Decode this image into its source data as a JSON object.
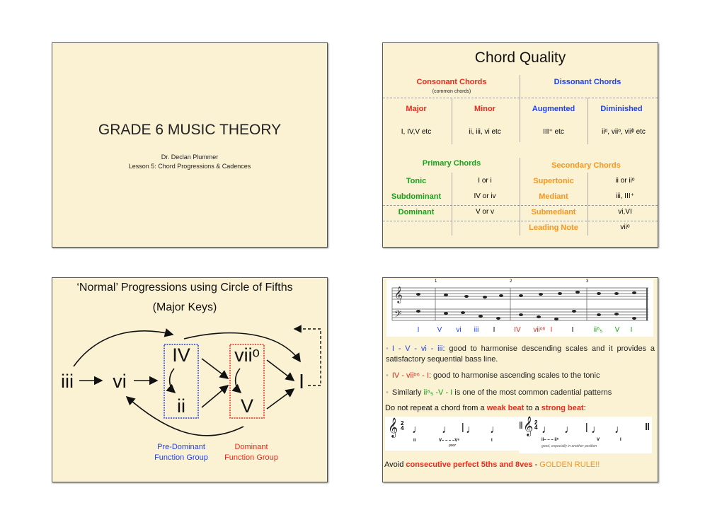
{
  "slide1": {
    "title": "GRADE 6 MUSIC THEORY",
    "author": "Dr. Declan Plummer",
    "lesson": "Lesson 5: Chord Progressions & Cadences"
  },
  "slide2": {
    "title": "Chord Quality",
    "consonant": "Consonant Chords",
    "consonant_note": "(common chords)",
    "dissonant": "Dissonant Chords",
    "types": [
      "Major",
      "Minor",
      "Augmented",
      "Diminished"
    ],
    "examples": [
      "I, IV,V etc",
      "ii, iii, vi etc",
      "III⁺ etc",
      "iiᵒ, viiᵒ, viiᶲ etc"
    ],
    "primary": "Primary Chords",
    "secondary": "Secondary Chords",
    "primary_rows": [
      [
        "Tonic",
        "I or i"
      ],
      [
        "Subdominant",
        "IV or iv"
      ],
      [
        "Dominant",
        "V or v"
      ]
    ],
    "secondary_rows": [
      [
        "Supertonic",
        "ii or iiᵒ"
      ],
      [
        "Mediant",
        "iii, III⁺"
      ],
      [
        "Submediant",
        "vi,VI"
      ],
      [
        "Leading Note",
        "viiᵒ"
      ]
    ]
  },
  "slide3": {
    "title1": "‘Normal’ Progressions using Circle of Fifths",
    "title2": "(Major Keys)",
    "nodes": {
      "iii": "iii",
      "vi": "vi",
      "IV": "IV",
      "ii": "ii",
      "vii": "viiᵒ",
      "V": "V",
      "I": "I"
    },
    "pre_dominant": [
      "Pre-Dominant",
      "Function Group"
    ],
    "dominant": [
      "Dominant",
      "Function Group"
    ],
    "colors": {
      "pre_dominant": "#1d3ff2",
      "dominant": "#ec2a1c"
    }
  },
  "slide4": {
    "score_labels": [
      "I",
      "V",
      "vi",
      "iii",
      "I",
      "IV",
      "viiᵒ⁶",
      "I",
      "I",
      "ii⁶₅",
      "V",
      "I"
    ],
    "measure_numbers": [
      "1",
      "2",
      "3"
    ],
    "bullet1_chords": "I - V - vi - iii",
    "bullet1_text": ": good to harmonise descending scales and it provides a satisfactory sequential bass line.",
    "bullet2_chords": "IV - viiᵒ⁶ - I",
    "bullet2_text": ": good to harmonise ascending scales to the tonic",
    "bullet3_pre": "Similarly ",
    "bullet3_chords": "ii⁶₅ -V - I",
    "bullet3_text": " is one of the most common cadential patterns",
    "repeat_pre": "Do not repeat a chord from a ",
    "weak_beat": "weak beat",
    "repeat_mid": " to a ",
    "strong_beat": "strong beat",
    "repeat_end": ":",
    "example1_labels": [
      "ii",
      "V– – – –V⁶",
      "I"
    ],
    "example1_caption": "poor",
    "example2_labels": [
      "ii– – – ii⁶",
      "V",
      "I"
    ],
    "example2_caption": "good, especially in another position",
    "avoid_pre": "Avoid ",
    "avoid_bold": "consecutive perfect 5ths and 8ves",
    "avoid_dash": " - ",
    "golden": "GOLDEN RULE!!"
  }
}
